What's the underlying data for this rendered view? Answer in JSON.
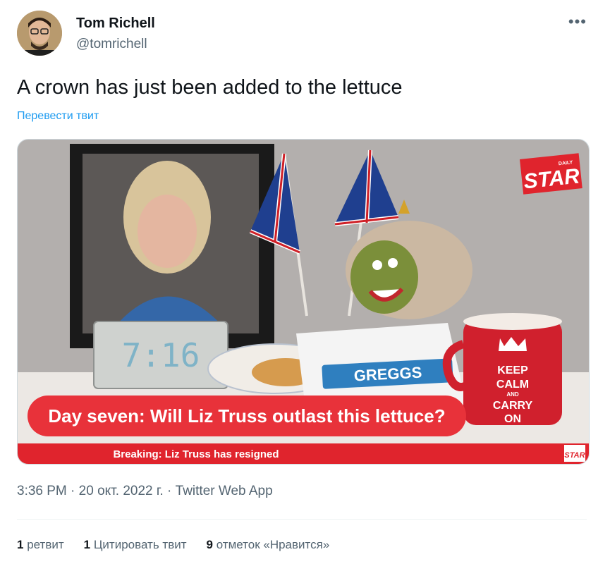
{
  "author": {
    "name": "Tom Richell",
    "handle": "@tomrichell"
  },
  "more_icon": "more-horizontal-icon",
  "tweet": {
    "text": "A crown has just been added to the lettuce",
    "translate_link": "Перевести твит"
  },
  "media": {
    "logo_top": "STAR",
    "logo_top_small": "DAILY",
    "caption": "Day seven: Will Liz Truss outlast this lettuce?",
    "ticker": "Breaking: Liz Truss has resigned",
    "logo_bottom": "STAR",
    "clock": "7:16",
    "bag_brand": "GREGGS",
    "mug_lines": [
      "KEEP",
      "CALM",
      "AND",
      "CARRY",
      "ON"
    ],
    "colors": {
      "brand_red": "#e0242d",
      "caption_red": "#e8323a"
    }
  },
  "meta": {
    "time": "3:36 PM",
    "date": "20 окт. 2022 г.",
    "sep": "·",
    "source": "Twitter Web App"
  },
  "stats": [
    {
      "count": "1",
      "label": "ретвит"
    },
    {
      "count": "1",
      "label": "Цитировать твит"
    },
    {
      "count": "9",
      "label": "отметок «Нравится»"
    }
  ]
}
